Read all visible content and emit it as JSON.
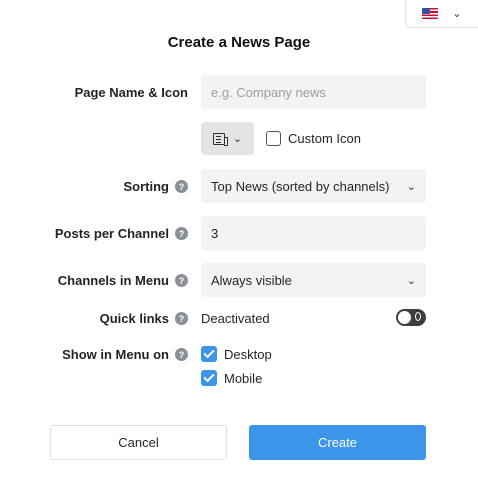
{
  "dialog": {
    "title": "Create a News Page"
  },
  "page_name": {
    "label": "Page Name & Icon",
    "placeholder": "e.g. Company news",
    "custom_icon_label": "Custom Icon"
  },
  "sorting": {
    "label": "Sorting",
    "value": "Top News (sorted by channels)"
  },
  "posts_per_channel": {
    "label": "Posts per Channel",
    "value": "3"
  },
  "channels_in_menu": {
    "label": "Channels in Menu",
    "value": "Always visible"
  },
  "quick_links": {
    "label": "Quick links",
    "status": "Deactivated"
  },
  "show_in_menu": {
    "label": "Show in Menu on",
    "options": [
      "Desktop",
      "Mobile"
    ]
  },
  "buttons": {
    "cancel": "Cancel",
    "create": "Create"
  },
  "icons": {
    "help": "?",
    "chevron": "⌄"
  },
  "colors": {
    "accent": "#3b95e8",
    "toggle_off": "#3a3d42"
  }
}
